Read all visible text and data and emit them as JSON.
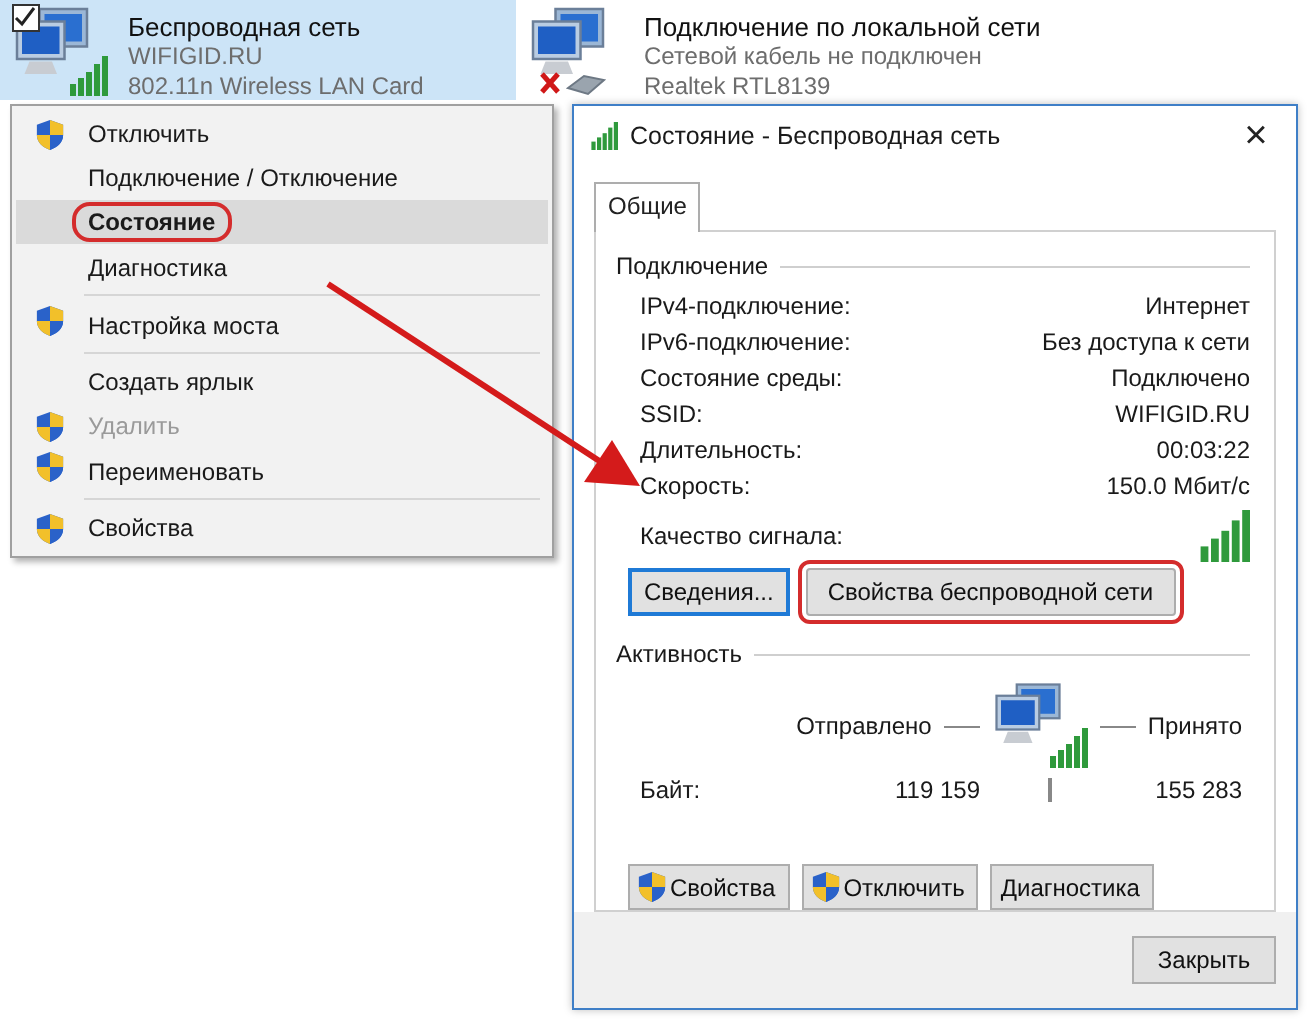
{
  "adapters": [
    {
      "name": "Беспроводная сеть",
      "line_2": "WIFIGID.RU",
      "line_3": "802.11n Wireless LAN Card",
      "selected": true,
      "kind": "wireless",
      "checkbox": {
        "checked": true
      }
    },
    {
      "name": "Подключение по локальной сети",
      "line_2": "Сетевой кабель не подключен",
      "line_3": "Realtek RTL8139",
      "selected": false,
      "kind": "wired"
    }
  ],
  "context_menu": {
    "items": [
      {
        "label": "Отключить",
        "shield": true,
        "selected": false,
        "disabled": false,
        "highlighted": false,
        "separator_after": false
      },
      {
        "label": "Подключение / Отключение",
        "shield": false,
        "selected": false,
        "disabled": false,
        "highlighted": false,
        "separator_after": false
      },
      {
        "label": "Состояние",
        "shield": false,
        "selected": true,
        "disabled": false,
        "highlighted": true,
        "separator_after": false
      },
      {
        "label": "Диагностика",
        "shield": false,
        "selected": false,
        "disabled": false,
        "highlighted": false,
        "separator_after": true
      },
      {
        "label": "Настройка моста",
        "shield": true,
        "selected": false,
        "disabled": false,
        "highlighted": false,
        "separator_after": true
      },
      {
        "label": "Создать ярлык",
        "shield": false,
        "selected": false,
        "disabled": false,
        "highlighted": false,
        "separator_after": false
      },
      {
        "label": "Удалить",
        "shield": true,
        "selected": false,
        "disabled": true,
        "highlighted": false,
        "separator_after": false
      },
      {
        "label": "Переименовать",
        "shield": true,
        "selected": false,
        "disabled": false,
        "highlighted": false,
        "separator_after": true
      },
      {
        "label": "Свойства",
        "shield": true,
        "selected": false,
        "disabled": false,
        "highlighted": false,
        "separator_after": false
      }
    ]
  },
  "dialog": {
    "title": "Состояние - Беспроводная сеть",
    "close": "×",
    "tabs": [
      {
        "label": "Общие",
        "selected": true
      }
    ],
    "connection": {
      "heading": "Подключение",
      "rows": [
        {
          "label": "IPv4-подключение:",
          "value": "Интернет"
        },
        {
          "label": "IPv6-подключение:",
          "value": "Без доступа к сети"
        },
        {
          "label": "Состояние среды:",
          "value": "Подключено"
        },
        {
          "label": "SSID:",
          "value": "WIFIGID.RU"
        },
        {
          "label": "Длительность:",
          "value": "00:03:22"
        },
        {
          "label": "Скорость:",
          "value": "150.0 Мбит/с"
        }
      ],
      "signal_label": "Качество сигнала:",
      "buttons": [
        {
          "label": "Сведения...",
          "focused": true,
          "highlighted": false
        },
        {
          "label": "Свойства беспроводной сети",
          "focused": false,
          "highlighted": true
        }
      ]
    },
    "activity": {
      "heading": "Активность",
      "sent_label": "Отправлено",
      "received_label": "Принято",
      "bytes_label": "Байт:",
      "bytes_sent": "119 159",
      "bytes_received": "155 283",
      "buttons": [
        {
          "label": "Свойства",
          "shield": true
        },
        {
          "label": "Отключить",
          "shield": true
        },
        {
          "label": "Диагностика",
          "shield": false
        }
      ]
    },
    "close_button": "Закрыть"
  }
}
